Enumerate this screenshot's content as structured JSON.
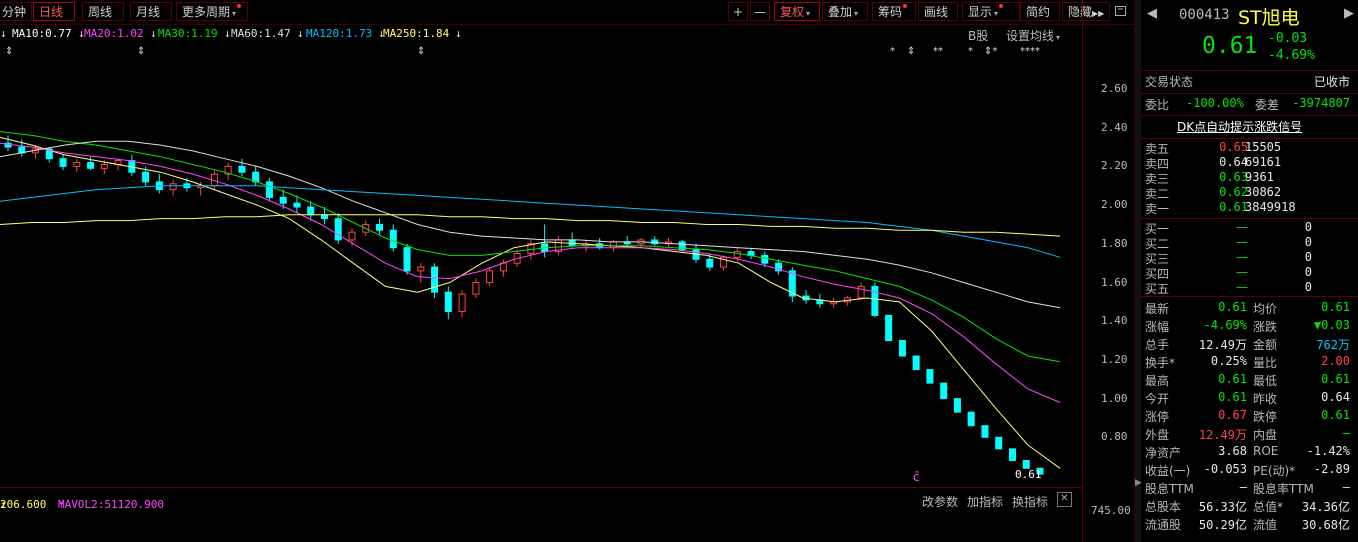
{
  "toolbar": {
    "tabs": [
      "分钟",
      "日线",
      "周线",
      "月线",
      "更多周期"
    ],
    "active": "日线",
    "right_buttons": [
      "+",
      "—",
      "复权",
      "叠加",
      "筹码",
      "画线",
      "显示",
      "简约",
      "隐藏"
    ]
  },
  "ma": [
    {
      "label": "MA10:0.77",
      "color": "#ffffff"
    },
    {
      "label": "MA20:1.02",
      "color": "#ff44ff"
    },
    {
      "label": "MA30:1.19",
      "color": "#00e600"
    },
    {
      "label": "MA60:1.47",
      "color": "#e0e0e0"
    },
    {
      "label": "MA120:1.73",
      "color": "#00c0ff"
    },
    {
      "label": "MA250:1.84",
      "color": "#ffff66"
    }
  ],
  "chart_opts": {
    "bshare": "B股",
    "settings": "设置均线"
  },
  "stars": [
    "⇕",
    "⇕",
    "⇕",
    "*",
    "⇕",
    "**",
    "*",
    "⇕*",
    "**",
    "***"
  ],
  "chart_data": {
    "type": "candlestick",
    "y_ticks": [
      2.6,
      2.4,
      2.2,
      2.0,
      1.8,
      1.6,
      1.4,
      1.2,
      1.0,
      0.8
    ],
    "ylim": [
      0.6,
      2.7
    ],
    "last_price_label": "0.61",
    "marker": "ĉ",
    "ohlc": [
      [
        2.32,
        2.36,
        2.28,
        2.3
      ],
      [
        2.3,
        2.34,
        2.25,
        2.27
      ],
      [
        2.27,
        2.31,
        2.24,
        2.29
      ],
      [
        2.29,
        2.3,
        2.22,
        2.24
      ],
      [
        2.24,
        2.26,
        2.18,
        2.2
      ],
      [
        2.2,
        2.24,
        2.17,
        2.22
      ],
      [
        2.22,
        2.25,
        2.18,
        2.19
      ],
      [
        2.19,
        2.23,
        2.16,
        2.21
      ],
      [
        2.21,
        2.24,
        2.18,
        2.23
      ],
      [
        2.23,
        2.26,
        2.15,
        2.17
      ],
      [
        2.17,
        2.2,
        2.1,
        2.12
      ],
      [
        2.12,
        2.16,
        2.06,
        2.08
      ],
      [
        2.08,
        2.13,
        2.05,
        2.11
      ],
      [
        2.11,
        2.14,
        2.07,
        2.09
      ],
      [
        2.09,
        2.12,
        2.05,
        2.1
      ],
      [
        2.1,
        2.18,
        2.08,
        2.16
      ],
      [
        2.16,
        2.22,
        2.13,
        2.2
      ],
      [
        2.2,
        2.24,
        2.15,
        2.17
      ],
      [
        2.17,
        2.2,
        2.1,
        2.12
      ],
      [
        2.12,
        2.14,
        2.02,
        2.04
      ],
      [
        2.04,
        2.08,
        1.98,
        2.01
      ],
      [
        2.01,
        2.05,
        1.96,
        1.99
      ],
      [
        1.99,
        2.02,
        1.92,
        1.95
      ],
      [
        1.95,
        1.99,
        1.9,
        1.93
      ],
      [
        1.93,
        1.96,
        1.8,
        1.82
      ],
      [
        1.82,
        1.88,
        1.79,
        1.86
      ],
      [
        1.86,
        1.92,
        1.84,
        1.9
      ],
      [
        1.9,
        1.93,
        1.85,
        1.87
      ],
      [
        1.87,
        1.9,
        1.76,
        1.78
      ],
      [
        1.78,
        1.8,
        1.64,
        1.66
      ],
      [
        1.66,
        1.7,
        1.6,
        1.68
      ],
      [
        1.68,
        1.7,
        1.52,
        1.55
      ],
      [
        1.55,
        1.58,
        1.41,
        1.45
      ],
      [
        1.45,
        1.56,
        1.42,
        1.54
      ],
      [
        1.54,
        1.62,
        1.52,
        1.6
      ],
      [
        1.6,
        1.68,
        1.58,
        1.66
      ],
      [
        1.66,
        1.72,
        1.63,
        1.7
      ],
      [
        1.7,
        1.77,
        1.68,
        1.75
      ],
      [
        1.75,
        1.82,
        1.72,
        1.8
      ],
      [
        1.8,
        1.9,
        1.73,
        1.76
      ],
      [
        1.76,
        1.84,
        1.74,
        1.82
      ],
      [
        1.82,
        1.86,
        1.78,
        1.79
      ],
      [
        1.79,
        1.82,
        1.76,
        1.8
      ],
      [
        1.8,
        1.83,
        1.77,
        1.78
      ],
      [
        1.78,
        1.82,
        1.76,
        1.81
      ],
      [
        1.81,
        1.84,
        1.79,
        1.8
      ],
      [
        1.8,
        1.83,
        1.78,
        1.82
      ],
      [
        1.82,
        1.84,
        1.79,
        1.8
      ],
      [
        1.8,
        1.83,
        1.78,
        1.81
      ],
      [
        1.81,
        1.82,
        1.76,
        1.77
      ],
      [
        1.77,
        1.8,
        1.7,
        1.72
      ],
      [
        1.72,
        1.75,
        1.66,
        1.68
      ],
      [
        1.68,
        1.74,
        1.66,
        1.73
      ],
      [
        1.73,
        1.78,
        1.71,
        1.76
      ],
      [
        1.76,
        1.78,
        1.72,
        1.74
      ],
      [
        1.74,
        1.76,
        1.68,
        1.7
      ],
      [
        1.7,
        1.72,
        1.64,
        1.66
      ],
      [
        1.66,
        1.68,
        1.5,
        1.53
      ],
      [
        1.53,
        1.56,
        1.49,
        1.51
      ],
      [
        1.51,
        1.54,
        1.47,
        1.49
      ],
      [
        1.49,
        1.52,
        1.47,
        1.5
      ],
      [
        1.5,
        1.53,
        1.48,
        1.52
      ],
      [
        1.52,
        1.6,
        1.51,
        1.58
      ],
      [
        1.58,
        1.6,
        1.42,
        1.43
      ],
      [
        1.43,
        1.43,
        1.3,
        1.3
      ],
      [
        1.3,
        1.3,
        1.22,
        1.22
      ],
      [
        1.22,
        1.22,
        1.15,
        1.15
      ],
      [
        1.15,
        1.15,
        1.08,
        1.08
      ],
      [
        1.08,
        1.08,
        1.0,
        1.0
      ],
      [
        1.0,
        1.0,
        0.93,
        0.93
      ],
      [
        0.93,
        0.93,
        0.86,
        0.86
      ],
      [
        0.86,
        0.86,
        0.8,
        0.8
      ],
      [
        0.8,
        0.8,
        0.74,
        0.74
      ],
      [
        0.74,
        0.74,
        0.68,
        0.68
      ],
      [
        0.68,
        0.68,
        0.64,
        0.64
      ],
      [
        0.64,
        0.64,
        0.61,
        0.61
      ]
    ],
    "series": [
      {
        "name": "MA10",
        "color": "#ffff88",
        "values": [
          2.35,
          2.31,
          2.26,
          2.23,
          2.2,
          2.17,
          2.12,
          2.06,
          2.0,
          1.93,
          1.82,
          1.7,
          1.58,
          1.55,
          1.6,
          1.7,
          1.78,
          1.81,
          1.8,
          1.79,
          1.78,
          1.76,
          1.74,
          1.7,
          1.6,
          1.52,
          1.5,
          1.52,
          1.5,
          1.35,
          1.15,
          0.95,
          0.76,
          0.64
        ]
      },
      {
        "name": "MA20",
        "color": "#ff44ff",
        "values": [
          2.32,
          2.3,
          2.27,
          2.25,
          2.23,
          2.2,
          2.16,
          2.11,
          2.05,
          1.98,
          1.9,
          1.8,
          1.7,
          1.63,
          1.62,
          1.66,
          1.72,
          1.76,
          1.78,
          1.78,
          1.78,
          1.77,
          1.75,
          1.72,
          1.68,
          1.63,
          1.59,
          1.56,
          1.52,
          1.44,
          1.32,
          1.18,
          1.05,
          0.98
        ]
      },
      {
        "name": "MA30",
        "color": "#00e600",
        "values": [
          2.38,
          2.36,
          2.33,
          2.31,
          2.28,
          2.25,
          2.21,
          2.17,
          2.12,
          2.06,
          1.99,
          1.91,
          1.83,
          1.77,
          1.74,
          1.74,
          1.76,
          1.78,
          1.79,
          1.79,
          1.79,
          1.78,
          1.77,
          1.75,
          1.72,
          1.69,
          1.66,
          1.62,
          1.58,
          1.51,
          1.42,
          1.31,
          1.22,
          1.19
        ]
      },
      {
        "name": "MA60",
        "color": "#e0e0e0",
        "values": [
          2.25,
          2.28,
          2.31,
          2.33,
          2.33,
          2.31,
          2.28,
          2.24,
          2.2,
          2.15,
          2.09,
          2.02,
          1.96,
          1.9,
          1.86,
          1.84,
          1.83,
          1.82,
          1.82,
          1.81,
          1.81,
          1.8,
          1.79,
          1.78,
          1.77,
          1.76,
          1.74,
          1.72,
          1.69,
          1.65,
          1.6,
          1.55,
          1.5,
          1.47
        ]
      },
      {
        "name": "MA120",
        "color": "#00c0ff",
        "values": [
          2.02,
          2.04,
          2.06,
          2.08,
          2.09,
          2.1,
          2.1,
          2.1,
          2.1,
          2.09,
          2.08,
          2.07,
          2.06,
          2.05,
          2.04,
          2.03,
          2.02,
          2.01,
          2.0,
          1.99,
          1.98,
          1.97,
          1.96,
          1.95,
          1.94,
          1.93,
          1.92,
          1.91,
          1.89,
          1.87,
          1.84,
          1.81,
          1.78,
          1.73
        ]
      },
      {
        "name": "MA250",
        "color": "#ffff66",
        "values": [
          1.9,
          1.91,
          1.91,
          1.92,
          1.92,
          1.93,
          1.93,
          1.94,
          1.94,
          1.95,
          1.95,
          1.95,
          1.95,
          1.95,
          1.94,
          1.94,
          1.93,
          1.93,
          1.92,
          1.92,
          1.91,
          1.91,
          1.9,
          1.9,
          1.89,
          1.89,
          1.88,
          1.88,
          1.87,
          1.87,
          1.86,
          1.86,
          1.85,
          1.84
        ]
      }
    ]
  },
  "volume": {
    "left_label": "206.600",
    "mavol2_label": "MAVOL2:51120.900",
    "axis_label": "745.00",
    "buttons": [
      "改参数",
      "加指标",
      "换指标"
    ],
    "close": "✕"
  },
  "quote": {
    "code": "000413",
    "name": "ST旭电",
    "price": "0.61",
    "change": "-0.03",
    "change_pct": "-4.69%",
    "status_label": "交易状态",
    "status_value": "已收市",
    "weibi_label": "委比",
    "weibi_value": "-100.00%",
    "weicha_label": "委差",
    "weicha_value": "-3974807",
    "dk_banner": "DK点自动提示涨跌信号",
    "sell": [
      {
        "label": "卖五",
        "price": "0.65",
        "vol": "15505",
        "color": "red"
      },
      {
        "label": "卖四",
        "price": "0.64",
        "vol": "69161",
        "color": "white"
      },
      {
        "label": "卖三",
        "price": "0.63",
        "vol": "9361",
        "color": "green"
      },
      {
        "label": "卖二",
        "price": "0.62",
        "vol": "30862",
        "color": "green"
      },
      {
        "label": "卖一",
        "price": "0.61",
        "vol": "3849918",
        "color": "green"
      }
    ],
    "buy": [
      {
        "label": "买一",
        "price": "—",
        "vol": "0"
      },
      {
        "label": "买二",
        "price": "—",
        "vol": "0"
      },
      {
        "label": "买三",
        "price": "—",
        "vol": "0"
      },
      {
        "label": "买四",
        "price": "—",
        "vol": "0"
      },
      {
        "label": "买五",
        "price": "—",
        "vol": "0"
      }
    ],
    "stats": [
      {
        "l1": "最新",
        "v1": "0.61",
        "c1": "green",
        "l2": "均价",
        "v2": "0.61",
        "c2": "green"
      },
      {
        "l1": "涨幅",
        "v1": "-4.69%",
        "c1": "green",
        "l2": "涨跌",
        "v2": "▼0.03",
        "c2": "green"
      },
      {
        "l1": "总手",
        "v1": "12.49万",
        "c1": "white",
        "l2": "金额",
        "v2": "762万",
        "c2": "cyan"
      },
      {
        "l1": "换手*",
        "v1": "0.25%",
        "c1": "white",
        "l2": "量比",
        "v2": "2.00",
        "c2": "red"
      },
      {
        "l1": "最高",
        "v1": "0.61",
        "c1": "green",
        "l2": "最低",
        "v2": "0.61",
        "c2": "green"
      },
      {
        "l1": "今开",
        "v1": "0.61",
        "c1": "green",
        "l2": "昨收",
        "v2": "0.64",
        "c2": "white"
      },
      {
        "l1": "涨停",
        "v1": "0.67",
        "c1": "red",
        "l2": "跌停",
        "v2": "0.61",
        "c2": "green"
      },
      {
        "l1": "外盘",
        "v1": "12.49万",
        "c1": "red",
        "l2": "内盘",
        "v2": "—",
        "c2": "green"
      },
      {
        "l1": "净资产",
        "v1": "3.68",
        "c1": "white",
        "l2": "ROE",
        "v2": "-1.42%",
        "c2": "white"
      },
      {
        "l1": "收益(一)",
        "v1": "-0.053",
        "c1": "white",
        "l2": "PE(动)*",
        "v2": "-2.89",
        "c2": "white"
      },
      {
        "l1": "股息TTM",
        "v1": "—",
        "c1": "white",
        "l2": "股息率TTM",
        "v2": "—",
        "c2": "white"
      },
      {
        "l1": "总股本",
        "v1": "56.33亿",
        "c1": "white",
        "l2": "总值*",
        "v2": "34.36亿",
        "c2": "white"
      },
      {
        "l1": "流通股",
        "v1": "50.29亿",
        "c1": "white",
        "l2": "流值",
        "v2": "30.68亿",
        "c2": "white"
      }
    ]
  }
}
